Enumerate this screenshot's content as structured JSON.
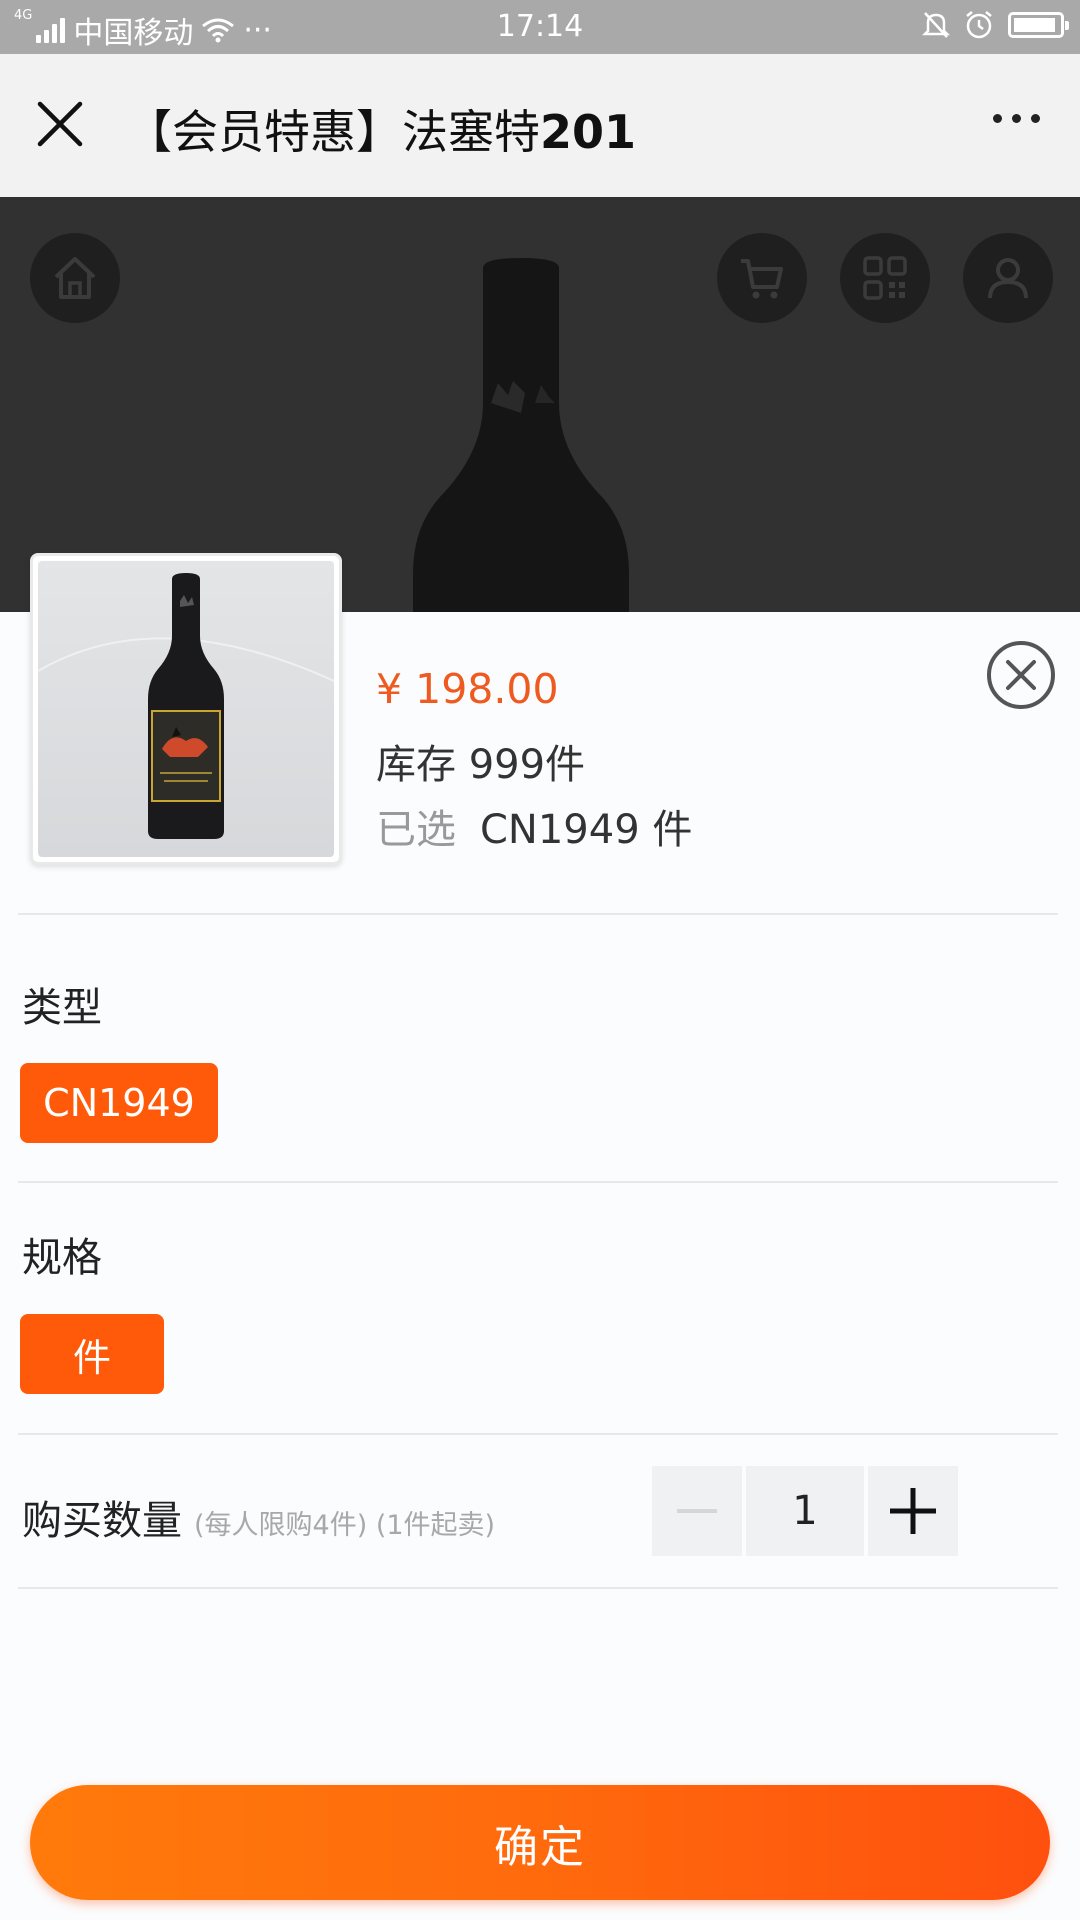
{
  "status_bar": {
    "network": "4G",
    "carrier": "中国移动",
    "dots": "···",
    "time": "17:14"
  },
  "header": {
    "title_text": "【会员特惠】法塞特",
    "title_num": "201"
  },
  "product": {
    "price": "¥ 198.00",
    "stock": "库存 999件",
    "selected_label": "已选",
    "selected_value": "CN1949 件"
  },
  "options": {
    "type_label": "类型",
    "type_value": "CN1949",
    "spec_label": "规格",
    "spec_value": "件"
  },
  "quantity": {
    "label": "购买数量",
    "hint": "(每人限购4件) (1件起卖)",
    "value": "1"
  },
  "confirm_label": "确定",
  "colors": {
    "accent": "#ff5a0a",
    "price": "#ee5a1f",
    "status_bar": "#a9a9a9",
    "banner": "#313131"
  },
  "icons": [
    "close-icon",
    "more-icon",
    "home-icon",
    "cart-icon",
    "qrcode-icon",
    "user-icon",
    "wifi-icon",
    "mute-icon",
    "alarm-icon",
    "battery-icon",
    "minus-icon",
    "plus-icon"
  ]
}
